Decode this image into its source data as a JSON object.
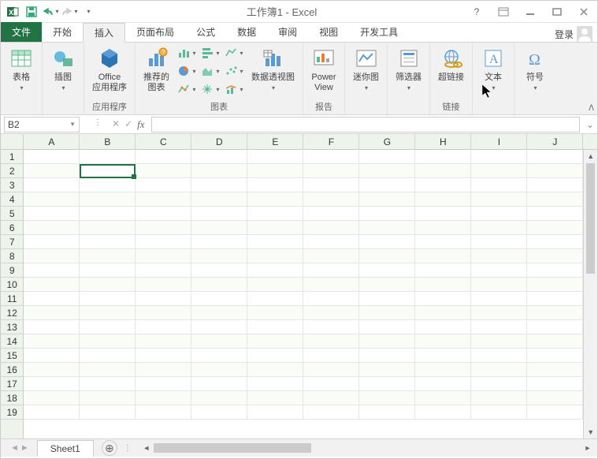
{
  "title": "工作簿1 - Excel",
  "qat": {
    "save": "save",
    "undo": "undo",
    "redo": "redo"
  },
  "tabs": {
    "file": "文件",
    "home": "开始",
    "insert": "插入",
    "layout": "页面布局",
    "formulas": "公式",
    "data": "数据",
    "review": "审阅",
    "view": "视图",
    "dev": "开发工具"
  },
  "login": "登录",
  "ribbon": {
    "tables": "表格",
    "illustrations": "插图",
    "office_apps": "Office\n应用程序",
    "recommended_charts": "推荐的\n图表",
    "pivot_chart": "数据透视图",
    "charts_label": "图表",
    "apps_label": "应用程序",
    "power_view": "Power\nView",
    "reports_label": "报告",
    "sparklines": "迷你图",
    "filter": "筛选器",
    "hyperlink": "超链接",
    "links_label": "链接",
    "text": "文本",
    "symbols": "符号"
  },
  "name_box": "B2",
  "columns": [
    "A",
    "B",
    "C",
    "D",
    "E",
    "F",
    "G",
    "H",
    "I",
    "J"
  ],
  "rows": [
    "1",
    "2",
    "3",
    "4",
    "5",
    "6",
    "7",
    "8",
    "9",
    "10",
    "11",
    "12",
    "13",
    "14",
    "15",
    "16",
    "17",
    "18",
    "19"
  ],
  "sheet_tab": "Sheet1"
}
